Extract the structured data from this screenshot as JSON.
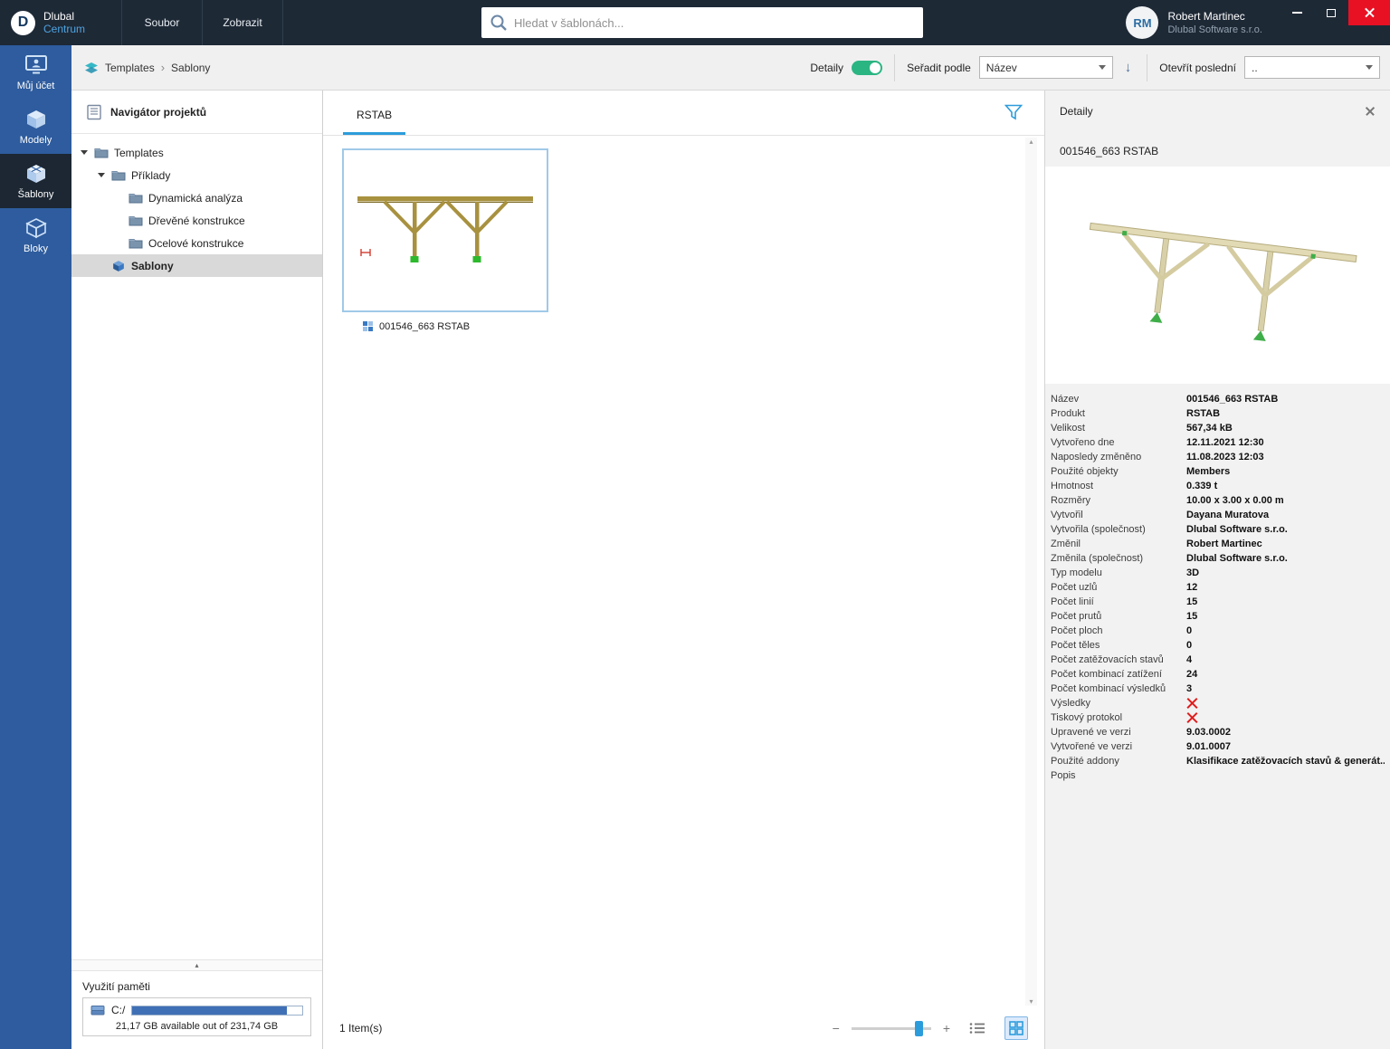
{
  "titlebar": {
    "app_name": "Dlubal",
    "app_sub": "Centrum",
    "menu": [
      "Soubor",
      "Zobrazit"
    ],
    "search_placeholder": "Hledat v šablonách...",
    "user": {
      "initials": "RM",
      "name": "Robert Martinec",
      "company": "Dlubal Software s.r.o."
    }
  },
  "sidebar": {
    "items": [
      {
        "label": "Můj účet",
        "icon": "account",
        "active": false
      },
      {
        "label": "Modely",
        "icon": "models",
        "active": false
      },
      {
        "label": "Šablony",
        "icon": "templates",
        "active": true
      },
      {
        "label": "Bloky",
        "icon": "blocks",
        "active": false
      }
    ]
  },
  "ribbon": {
    "breadcrumb": [
      "Templates",
      "Sablony"
    ],
    "details_label": "Detaily",
    "sort_label": "Seřadit podle",
    "sort_value": "Název",
    "recent_label": "Otevřít poslední",
    "recent_value": ".."
  },
  "navigator": {
    "title": "Navigátor projektů",
    "tree": [
      {
        "label": "Templates",
        "level": 0,
        "icon": "folder",
        "expander": true
      },
      {
        "label": "Příklady",
        "level": 1,
        "icon": "folder",
        "expander": true
      },
      {
        "label": "Dynamická analýza",
        "level": 2,
        "icon": "folder",
        "expander": false
      },
      {
        "label": "Dřevěné konstrukce",
        "level": 2,
        "icon": "folder",
        "expander": false
      },
      {
        "label": "Ocelové konstrukce",
        "level": 2,
        "icon": "folder",
        "expander": false
      },
      {
        "label": "Sablony",
        "level": 1,
        "icon": "template",
        "expander": false,
        "selected": true
      }
    ],
    "memory": {
      "title": "Využití paměti",
      "drive": "C:/",
      "used_percent": 91,
      "text": "21,17 GB available out of 231,74 GB"
    }
  },
  "main": {
    "tab": "RSTAB",
    "items": [
      {
        "label": "001546_663 RSTAB",
        "selected": true
      }
    ],
    "status": "1 Item(s)"
  },
  "details": {
    "title": "Detaily",
    "item_title": "001546_663 RSTAB",
    "properties": [
      {
        "label": "Název",
        "value": "001546_663 RSTAB"
      },
      {
        "label": "Produkt",
        "value": "RSTAB"
      },
      {
        "label": "Velikost",
        "value": "567,34 kB"
      },
      {
        "label": "Vytvořeno dne",
        "value": "12.11.2021 12:30"
      },
      {
        "label": "Naposledy změněno",
        "value": "11.08.2023 12:03"
      },
      {
        "label": "Použité objekty",
        "value": "Members"
      },
      {
        "label": "Hmotnost",
        "value": "0.339 t"
      },
      {
        "label": "Rozměry",
        "value": "10.00 x 3.00 x 0.00 m"
      },
      {
        "label": "Vytvořil",
        "value": "Dayana Muratova"
      },
      {
        "label": "Vytvořila (společnost)",
        "value": "Dlubal Software s.r.o."
      },
      {
        "label": "Změnil",
        "value": "Robert Martinec"
      },
      {
        "label": "Změnila (společnost)",
        "value": "Dlubal Software s.r.o."
      },
      {
        "label": "Typ modelu",
        "value": "3D"
      },
      {
        "label": "Počet uzlů",
        "value": "12"
      },
      {
        "label": "Počet linií",
        "value": "15"
      },
      {
        "label": "Počet prutů",
        "value": "15"
      },
      {
        "label": "Počet ploch",
        "value": "0"
      },
      {
        "label": "Počet těles",
        "value": "0"
      },
      {
        "label": "Počet zatěžovacích stavů",
        "value": "4"
      },
      {
        "label": "Počet kombinací zatížení",
        "value": "24"
      },
      {
        "label": "Počet kombinací výsledků",
        "value": "3"
      },
      {
        "label": "Výsledky",
        "value": "",
        "x": true
      },
      {
        "label": "Tiskový protokol",
        "value": "",
        "x": true
      },
      {
        "label": "Upravené ve verzi",
        "value": "9.03.0002"
      },
      {
        "label": "Vytvořené ve verzi",
        "value": "9.01.0007"
      },
      {
        "label": "Použité addony",
        "value": "Klasifikace zatěžovacích stavů & generát..."
      },
      {
        "label": "Popis",
        "value": ""
      }
    ]
  },
  "icons": {
    "sort_desc": "↓",
    "breadcrumb_sep": "›",
    "splitter_up": "▴",
    "zoom_minus": "−",
    "zoom_plus": "+",
    "scroll_up": "▴",
    "scroll_down": "▾"
  },
  "colors": {
    "accent": "#2d9cdb",
    "sidebar": "#2e5c9e",
    "titlebar": "#1e2936",
    "toggle_on": "#2bb583",
    "close_button": "#e81123",
    "red_x": "#e01b1b"
  }
}
